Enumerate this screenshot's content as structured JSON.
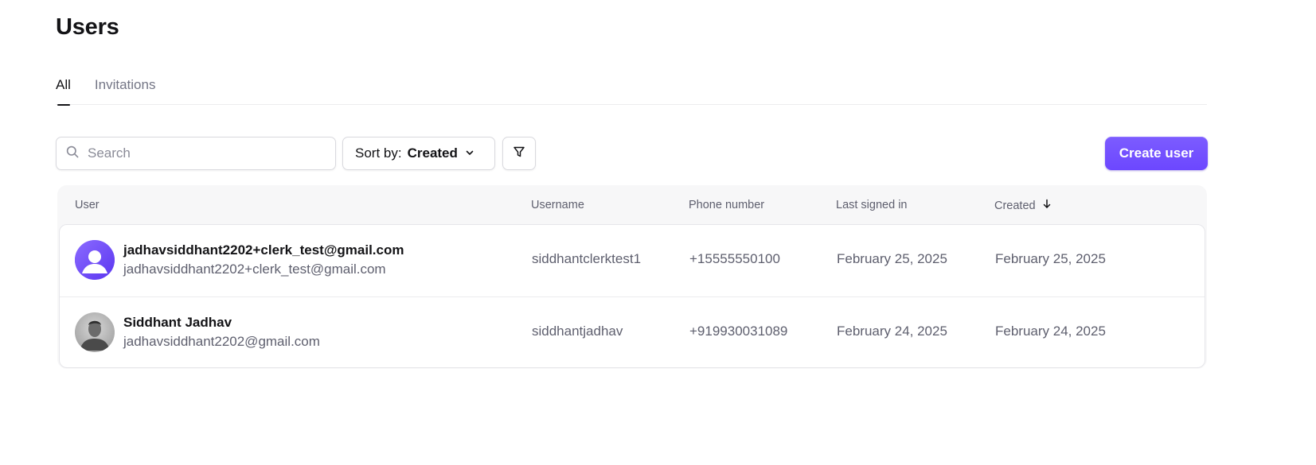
{
  "page": {
    "title": "Users"
  },
  "tabs": [
    {
      "label": "All",
      "active": true
    },
    {
      "label": "Invitations",
      "active": false
    }
  ],
  "toolbar": {
    "search_placeholder": "Search",
    "search_value": "",
    "sort_prefix": "Sort by:",
    "sort_value": "Created",
    "create_label": "Create user"
  },
  "table": {
    "columns": {
      "user": "User",
      "username": "Username",
      "phone": "Phone number",
      "last_signed_in": "Last signed in",
      "created": "Created"
    },
    "sort_column": "created",
    "sort_direction": "descending",
    "rows": [
      {
        "primary": "jadhavsiddhant2202+clerk_test@gmail.com",
        "secondary": "jadhavsiddhant2202+clerk_test@gmail.com",
        "username": "siddhantclerktest1",
        "phone": "+15555550100",
        "last_signed_in": "February 25, 2025",
        "created": "February 25, 2025",
        "avatar": "default-user-avatar"
      },
      {
        "primary": "Siddhant Jadhav",
        "secondary": "jadhavsiddhant2202@gmail.com",
        "username": "siddhantjadhav",
        "phone": "+919930031089",
        "last_signed_in": "February 24, 2025",
        "created": "February 24, 2025",
        "avatar": "profile-photo"
      }
    ]
  },
  "colors": {
    "accent": "#6c47ff",
    "text_primary": "#131316",
    "text_secondary": "#5e5f6e",
    "border": "#d9d9de",
    "table_header_bg": "#f7f7f8"
  },
  "icons": {
    "search": "search-icon",
    "sort_chevron": "chevron-down-icon",
    "filter": "filter-icon",
    "sort_arrow": "arrow-down-icon"
  }
}
